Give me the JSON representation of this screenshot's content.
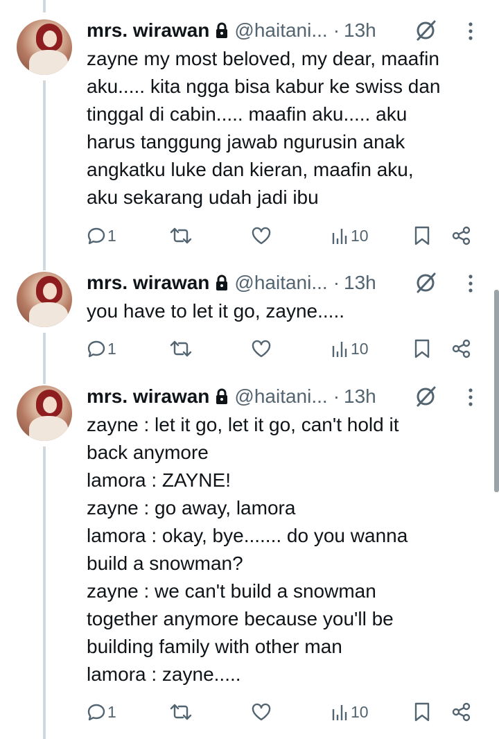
{
  "colors": {
    "text": "#0f1419",
    "secondary": "#536471",
    "thread_line": "#cfd9de",
    "background": "#ffffff"
  },
  "tweets": [
    {
      "name": "mrs. wirawan",
      "handle": "@haitani...",
      "separator": "·",
      "time": "13h",
      "icons": [
        "lock-icon",
        "grok-icon",
        "more-icon"
      ],
      "text": "zayne my most beloved, my dear, maafin\naku..... kita ngga bisa kabur ke swiss dan\ntinggal di cabin..... maafin aku..... aku\nharus tanggung jawab ngurusin anak\nangkatku luke dan kieran, maafin aku,\naku sekarang udah jadi ibu",
      "replies": "1",
      "views": "10"
    },
    {
      "name": "mrs. wirawan",
      "handle": "@haitani...",
      "separator": "·",
      "time": "13h",
      "icons": [
        "lock-icon",
        "grok-icon",
        "more-icon"
      ],
      "text": "you have to let it go, zayne.....",
      "replies": "1",
      "views": "10"
    },
    {
      "name": "mrs. wirawan",
      "handle": "@haitani...",
      "separator": "·",
      "time": "13h",
      "icons": [
        "lock-icon",
        "grok-icon",
        "more-icon"
      ],
      "text": "zayne : let it go, let it go, can't hold it\nback anymore\nlamora : ZAYNE!\nzayne : go away, lamora\nlamora : okay, bye....... do you wanna\nbuild a snowman?\nzayne : we can't build a snowman\ntogether anymore because you'll be\nbuilding family with other man\nlamora : zayne.....",
      "replies": "1",
      "views": "10"
    }
  ]
}
